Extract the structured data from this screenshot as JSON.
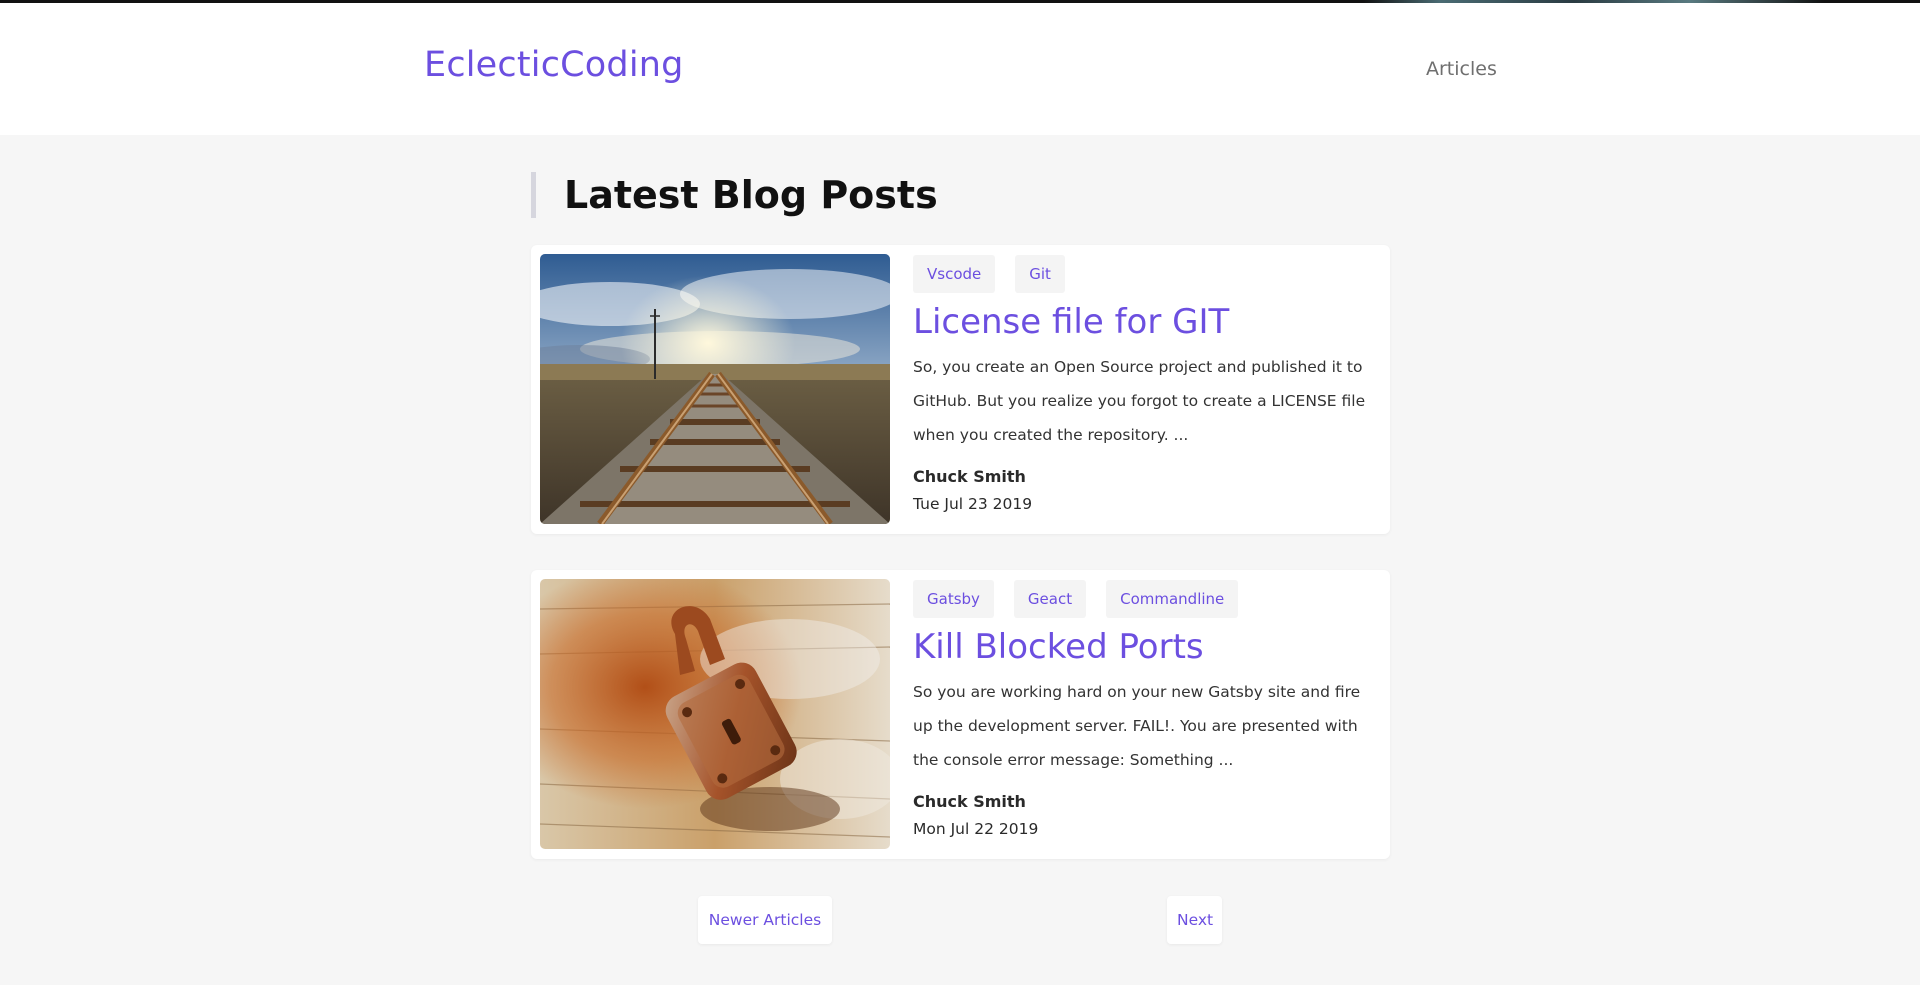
{
  "header": {
    "brand": "EclecticCoding",
    "nav": {
      "articles": "Articles"
    }
  },
  "main": {
    "heading": "Latest Blog Posts",
    "posts": [
      {
        "tags": [
          "Vscode",
          "Git"
        ],
        "title": "License file for GIT",
        "excerpt": "So, you create an Open Source project and published it to GitHub. But you realize you forgot to create a LICENSE file when you created the repository. ...",
        "author": "Chuck Smith",
        "date": "Tue Jul 23 2019",
        "image": "railroad-tracks-photo"
      },
      {
        "tags": [
          "Gatsby",
          "Geact",
          "Commandline"
        ],
        "title": "Kill Blocked Ports",
        "excerpt": "So you are working hard on your new Gatsby site and fire up the development server. FAIL!. You are presented with the console error message: Something ...",
        "author": "Chuck Smith",
        "date": "Mon Jul 22 2019",
        "image": "rusty-padlock-photo"
      }
    ]
  },
  "pagination": {
    "newer": "Newer Articles",
    "next": "Next"
  },
  "colors": {
    "accent": "#6c4fe0",
    "background": "#f6f6f6",
    "card": "#ffffff",
    "tag_bg": "#f4f4f4"
  }
}
